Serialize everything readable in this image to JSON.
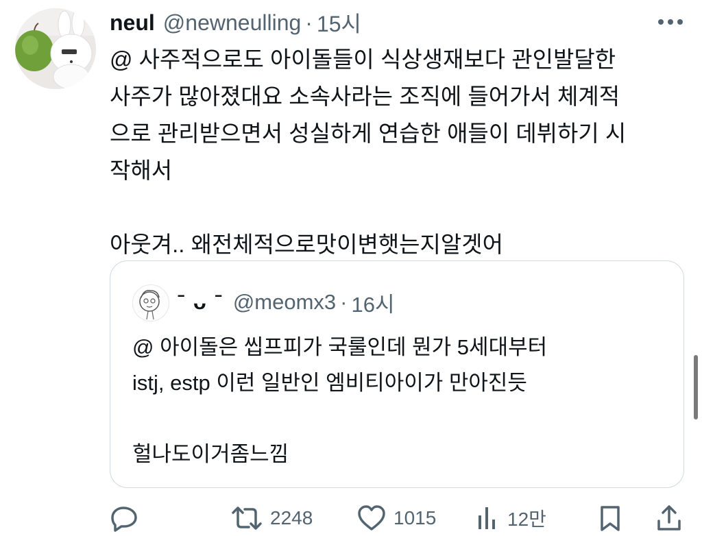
{
  "tweet": {
    "author_name": "neul",
    "author_handle": "@newneulling",
    "separator": "·",
    "time": "15시",
    "lines": [
      "@ 사주적으로도 아이돌들이 식상생재보다 관인발달한",
      "사주가 많아졌대요 소속사라는 조직에 들어가서 체계적",
      "으로 관리받으면서 성실하게 연습한 애들이 데뷔하기 시",
      "작해서"
    ],
    "lines2": [
      "아웃겨.. 왜전체적으로맛이변햇는지알겟어"
    ]
  },
  "quote": {
    "author_name": "ˉ ᴗ ˉ",
    "author_handle": "@meomx3",
    "separator": "·",
    "time": "16시",
    "lines": [
      "@ 아이돌은 씹프피가 국룰인데 뭔가 5세대부터",
      "istj, estp 이런 일반인 엠비티아이가 만아진듯"
    ],
    "lines2": [
      "헐나도이거좀느낌"
    ]
  },
  "actions": {
    "reply_count": "",
    "retweet_count": "2248",
    "like_count": "1015",
    "views_count": "12만"
  },
  "icons": {
    "reply": "reply-icon",
    "retweet": "retweet-icon",
    "like": "heart-icon",
    "views": "views-icon",
    "bookmark": "bookmark-icon",
    "share": "share-icon",
    "more": "more-icon"
  },
  "colors": {
    "text": "#0f1419",
    "secondary": "#536471",
    "border": "#cfd9de"
  }
}
